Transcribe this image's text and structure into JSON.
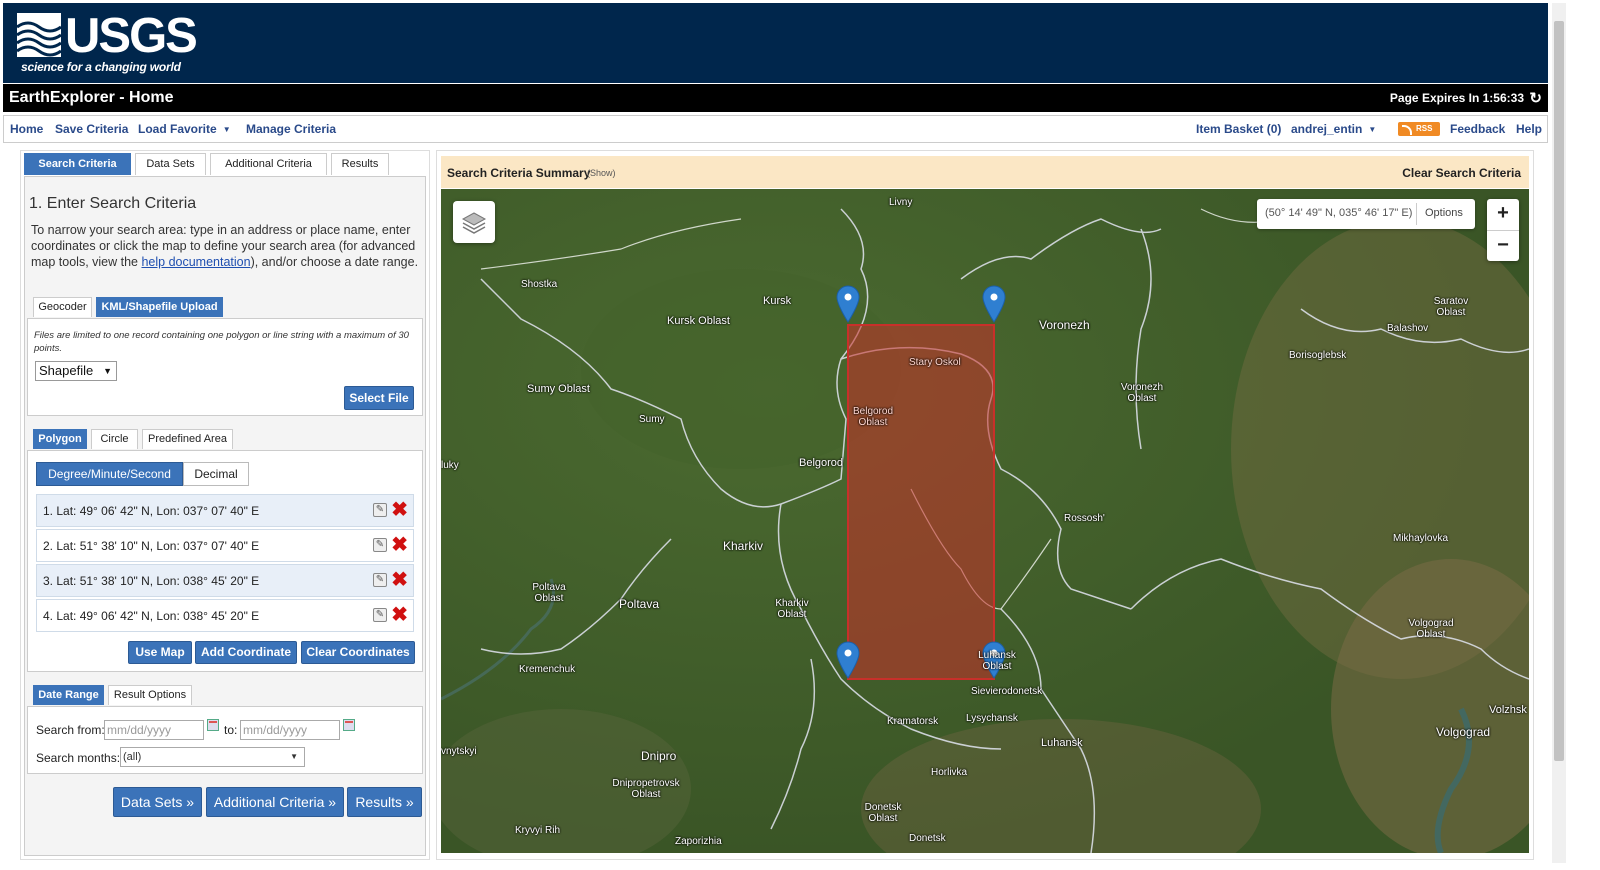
{
  "header": {
    "logo_text": "USGS",
    "tagline": "science for a changing world",
    "app_title": "EarthExplorer - Home",
    "page_expires": "Page Expires In 1:56:33"
  },
  "navbar": {
    "home": "Home",
    "save_criteria": "Save Criteria",
    "load_favorite": "Load Favorite",
    "manage_criteria": "Manage Criteria",
    "item_basket": "Item Basket (0)",
    "user": "andrej_entin",
    "rss": "RSS",
    "feedback": "Feedback",
    "help": "Help"
  },
  "main_tabs": [
    "Search Criteria",
    "Data Sets",
    "Additional Criteria",
    "Results"
  ],
  "search": {
    "heading": "1. Enter Search Criteria",
    "instructions_pre": "To narrow your search area: type in an address or place name, enter coordinates or click the map to define your search area (for advanced map tools, view the ",
    "instructions_link": "help documentation",
    "instructions_post": "), and/or choose a date range."
  },
  "upload_tabs": [
    "Geocoder",
    "KML/Shapefile Upload"
  ],
  "upload": {
    "note": "Files are limited to one record containing one polygon or line string with a maximum of 30 points.",
    "file_type": "Shapefile",
    "select_file": "Select File"
  },
  "shape_tabs": [
    "Polygon",
    "Circle",
    "Predefined Area"
  ],
  "format_tabs": [
    "Degree/Minute/Second",
    "Decimal"
  ],
  "coordinates": [
    "1.   Lat: 49° 06' 42\" N, Lon: 037° 07' 40\" E",
    "2.   Lat: 51° 38' 10\" N, Lon: 037° 07' 40\" E",
    "3.   Lat: 51° 38' 10\" N, Lon: 038° 45' 20\" E",
    "4.   Lat: 49° 06' 42\" N, Lon: 038° 45' 20\" E"
  ],
  "coord_buttons": {
    "use_map": "Use Map",
    "add_coordinate": "Add Coordinate",
    "clear_coordinates": "Clear Coordinates"
  },
  "date_tabs": [
    "Date Range",
    "Result Options"
  ],
  "date": {
    "from_label": "Search from:",
    "from_placeholder": "mm/dd/yyyy",
    "to_label": "to:",
    "to_placeholder": "mm/dd/yyyy",
    "months_label": "Search months:",
    "months_value": "(all)"
  },
  "bottom_buttons": {
    "data_sets": "Data Sets »",
    "additional_criteria": "Additional Criteria »",
    "results": "Results »"
  },
  "summary": {
    "title": "Search Criteria Summary",
    "show": "(Show)",
    "clear": "Clear Search Criteria"
  },
  "map": {
    "coord_readout": "(50° 14' 49\" N, 035° 46' 17\" E)",
    "options": "Options",
    "zoom_in": "+",
    "zoom_out": "−",
    "labels": {
      "livny": "Livny",
      "shostka": "Shostka",
      "kursk": "Kursk",
      "kursk_oblast": "Kursk Oblast",
      "voronezh": "Voronezh",
      "saratov_oblast": "Saratov Oblast",
      "balashov": "Balashov",
      "borisoglebsk": "Borisoglebsk",
      "stary_oskol": "Stary Oskol",
      "sumy_oblast": "Sumy Oblast",
      "sumy": "Sumy",
      "belgorod_oblast": "Belgorod Oblast",
      "voronezh_oblast": "Voronezh Oblast",
      "belgorod": "Belgorod",
      "luky": "luky",
      "rossosh": "Rossosh'",
      "kharkiv": "Kharkiv",
      "mikhaylovka": "Mikhaylovka",
      "poltava_oblast": "Poltava Oblast",
      "poltava": "Poltava",
      "kharkiv_oblast": "Kharkiv Oblast",
      "volgograd_oblast": "Volgograd Oblast",
      "luhansk_oblast": "Luhansk Oblast",
      "kremenchuk": "Kremenchuk",
      "sievierodonetsk": "Sievierodonetsk",
      "kramatorsk": "Kramatorsk",
      "lysychansk": "Lysychansk",
      "volzhsk": "Volzhsk",
      "volgograd": "Volgograd",
      "luhansk": "Luhansk",
      "vnytskyi": "vnytskyi",
      "dnipro": "Dnipro",
      "horlivka": "Horlivka",
      "dnipropetrovsk_oblast": "Dnipropetrovsk Oblast",
      "donetsk_oblast": "Donetsk Oblast",
      "kryvyi_rih": "Kryvyi Rih",
      "zaporizhia": "Zaporizhia",
      "donetsk": "Donetsk"
    }
  },
  "colors": {
    "header_bg": "#00264c",
    "accent": "#3b73b9",
    "aoi_fill": "#c8302a",
    "marker": "#2f7fd1",
    "summary_bg": "#fbe7c5"
  }
}
